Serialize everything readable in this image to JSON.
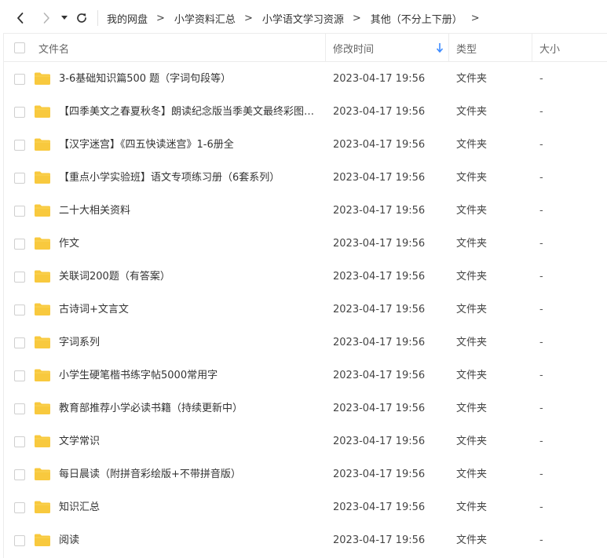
{
  "nav": {
    "back_icon": "chevron-left-icon",
    "forward_icon": "chevron-right-icon",
    "dropdown_icon": "caret-down-icon",
    "refresh_icon": "refresh-icon"
  },
  "breadcrumb": {
    "items": [
      "我的网盘",
      "小学资料汇总",
      "小学语文学习资源",
      "其他（不分上下册）"
    ],
    "separator": ">"
  },
  "table": {
    "headers": {
      "name": "文件名",
      "mtime": "修改时间",
      "type": "类型",
      "size": "大小"
    },
    "sort_icon": "arrow-down-icon",
    "sort_color": "#3d8bff",
    "folder_color": "#f8c93e",
    "rows": [
      {
        "name": "3-6基础知识篇500 题（字词句段等）",
        "mtime": "2023-04-17 19:56",
        "type": "文件夹",
        "size": "-"
      },
      {
        "name": "【四季美文之春夏秋冬】朗读纪念版当季美文最终彩图高...",
        "mtime": "2023-04-17 19:56",
        "type": "文件夹",
        "size": "-"
      },
      {
        "name": "【汉字迷宫】《四五快读迷宫》1-6册全",
        "mtime": "2023-04-17 19:56",
        "type": "文件夹",
        "size": "-"
      },
      {
        "name": "【重点小学实验班】语文专项练习册（6套系列）",
        "mtime": "2023-04-17 19:56",
        "type": "文件夹",
        "size": "-"
      },
      {
        "name": "二十大相关资料",
        "mtime": "2023-04-17 19:56",
        "type": "文件夹",
        "size": "-"
      },
      {
        "name": "作文",
        "mtime": "2023-04-17 19:56",
        "type": "文件夹",
        "size": "-"
      },
      {
        "name": "关联词200题（有答案）",
        "mtime": "2023-04-17 19:56",
        "type": "文件夹",
        "size": "-"
      },
      {
        "name": "古诗词+文言文",
        "mtime": "2023-04-17 19:56",
        "type": "文件夹",
        "size": "-"
      },
      {
        "name": "字词系列",
        "mtime": "2023-04-17 19:56",
        "type": "文件夹",
        "size": "-"
      },
      {
        "name": "小学生硬笔楷书练字帖5000常用字",
        "mtime": "2023-04-17 19:56",
        "type": "文件夹",
        "size": "-"
      },
      {
        "name": "教育部推荐小学必读书籍（持续更新中）",
        "mtime": "2023-04-17 19:56",
        "type": "文件夹",
        "size": "-"
      },
      {
        "name": "文学常识",
        "mtime": "2023-04-17 19:56",
        "type": "文件夹",
        "size": "-"
      },
      {
        "name": "每日晨读（附拼音彩绘版+不带拼音版）",
        "mtime": "2023-04-17 19:56",
        "type": "文件夹",
        "size": "-"
      },
      {
        "name": "知识汇总",
        "mtime": "2023-04-17 19:56",
        "type": "文件夹",
        "size": "-"
      },
      {
        "name": "阅读",
        "mtime": "2023-04-17 19:56",
        "type": "文件夹",
        "size": "-"
      }
    ]
  }
}
